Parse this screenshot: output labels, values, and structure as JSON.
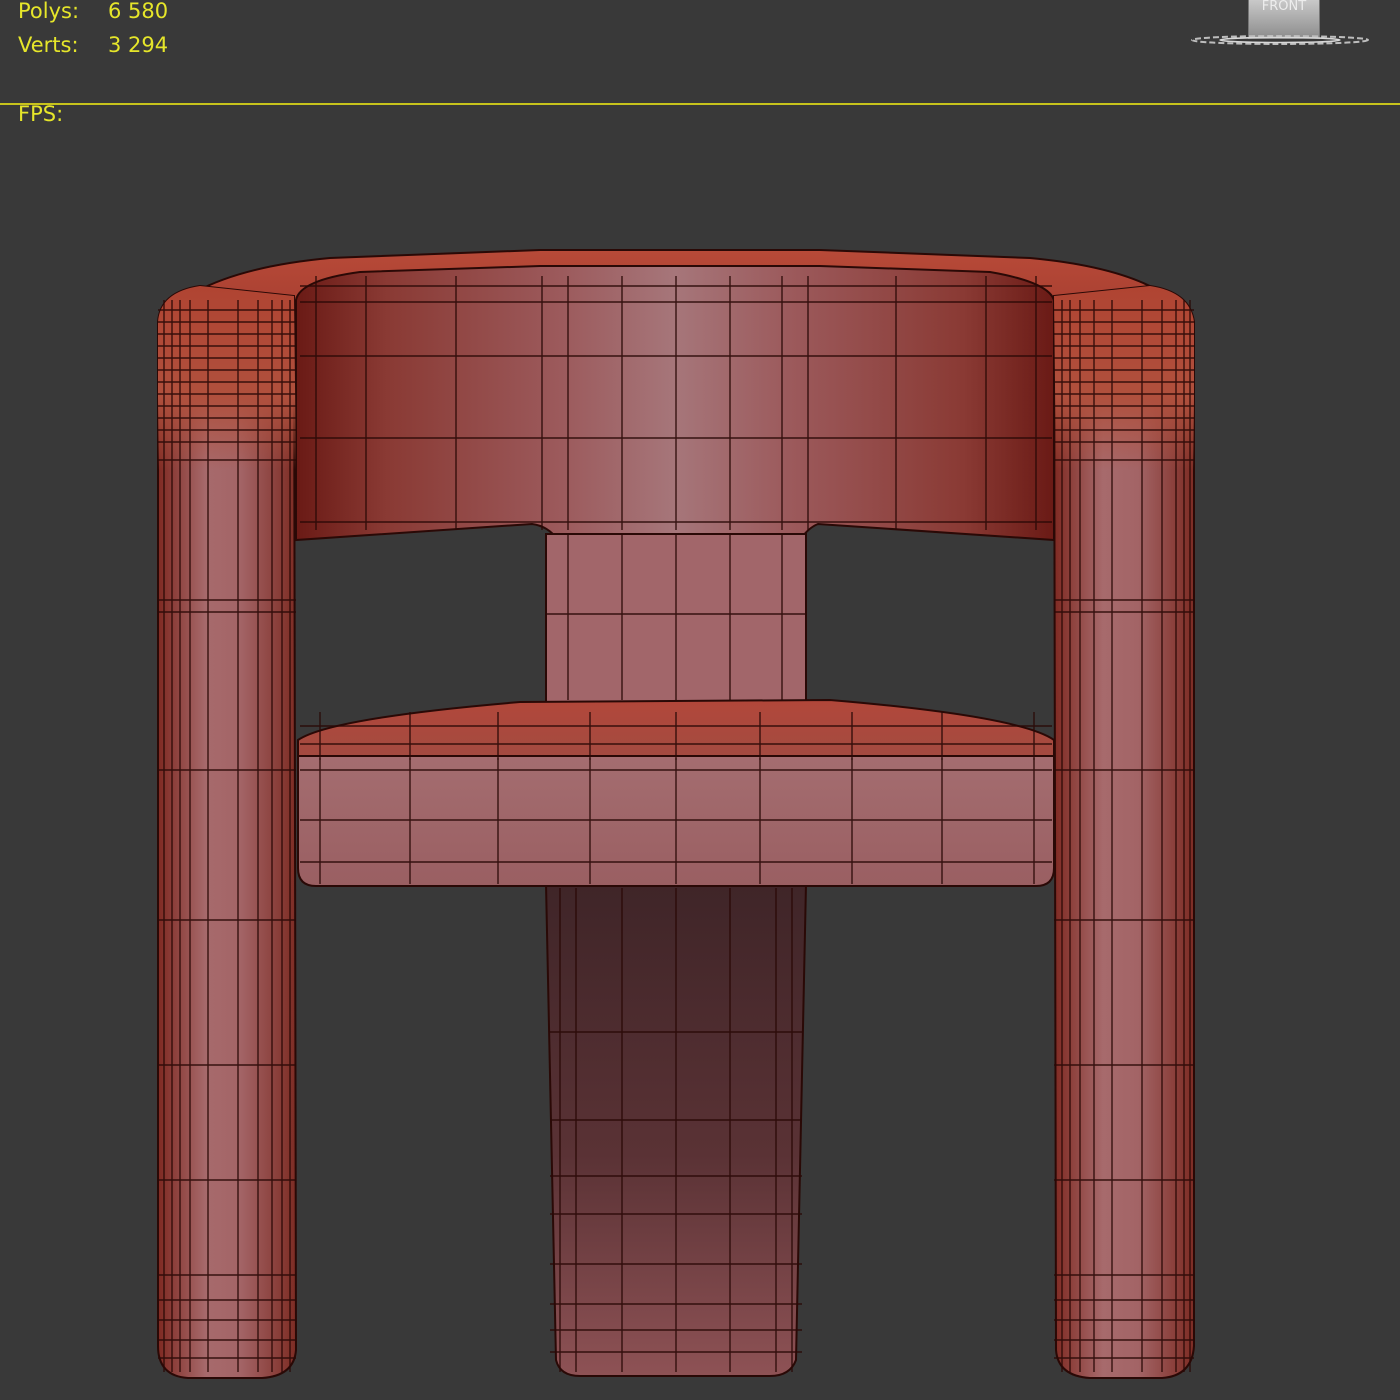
{
  "stats": {
    "polys_label": "Polys:",
    "polys_value": "6 580",
    "verts_label": "Verts:",
    "verts_value": "3 294",
    "fps_label": "FPS:",
    "fps_value": ""
  },
  "viewcube": {
    "face_label": "FRONT"
  },
  "colors": {
    "background": "#393939",
    "overlay_text": "#e6e62a",
    "separator": "#c7c31c",
    "mesh_dark": "#7a261c",
    "mesh_mid": "#a5483a",
    "mesh_light": "#a8767a",
    "wire": "#2a0906"
  }
}
